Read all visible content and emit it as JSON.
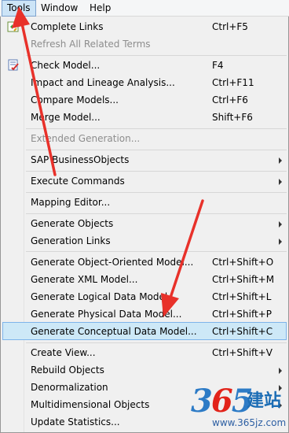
{
  "menubar": {
    "items": [
      {
        "label": "Tools",
        "active": true
      },
      {
        "label": "Window",
        "active": false
      },
      {
        "label": "Help",
        "active": false
      }
    ]
  },
  "tools_menu": {
    "items": [
      {
        "label": "Complete Links",
        "shortcut": "Ctrl+F5",
        "icon": "complete-links-icon"
      },
      {
        "label": "Refresh All Related Terms",
        "shortcut": "",
        "disabled": true
      },
      {
        "label": "Check Model...",
        "shortcut": "F4",
        "icon": "check-model-icon"
      },
      {
        "label": "Impact and Lineage Analysis...",
        "shortcut": "Ctrl+F11"
      },
      {
        "label": "Compare Models...",
        "shortcut": "Ctrl+F6"
      },
      {
        "label": "Merge Model...",
        "shortcut": "Shift+F6"
      },
      {
        "label": "Extended Generation...",
        "shortcut": "",
        "disabled": true
      },
      {
        "label": "SAP BusinessObjects",
        "submenu": true
      },
      {
        "label": "Execute Commands",
        "submenu": true
      },
      {
        "label": "Mapping Editor...",
        "shortcut": ""
      },
      {
        "label": "Generate Objects",
        "submenu": true
      },
      {
        "label": "Generation Links",
        "submenu": true
      },
      {
        "label": "Generate Object-Oriented Model...",
        "shortcut": "Ctrl+Shift+O"
      },
      {
        "label": "Generate XML Model...",
        "shortcut": "Ctrl+Shift+M"
      },
      {
        "label": "Generate Logical Data Model...",
        "shortcut": "Ctrl+Shift+L"
      },
      {
        "label": "Generate Physical Data Model...",
        "shortcut": "Ctrl+Shift+P"
      },
      {
        "label": "Generate Conceptual Data Model...",
        "shortcut": "Ctrl+Shift+C",
        "highlighted": true
      },
      {
        "label": "Create View...",
        "shortcut": "Ctrl+Shift+V"
      },
      {
        "label": "Rebuild Objects",
        "submenu": true
      },
      {
        "label": "Denormalization",
        "submenu": true
      },
      {
        "label": "Multidimensional Objects",
        "submenu": true
      },
      {
        "label": "Update Statistics...",
        "shortcut": ""
      }
    ]
  },
  "colors": {
    "highlight_bg": "#cde8f7",
    "highlight_border": "#7eb4ea",
    "annotation_arrow": "#e8312a",
    "disabled_text": "#8d8d8d"
  },
  "watermark": {
    "digits": [
      "3",
      "6",
      "5"
    ],
    "cn_text": "建站",
    "url": "www.365jz.com"
  }
}
